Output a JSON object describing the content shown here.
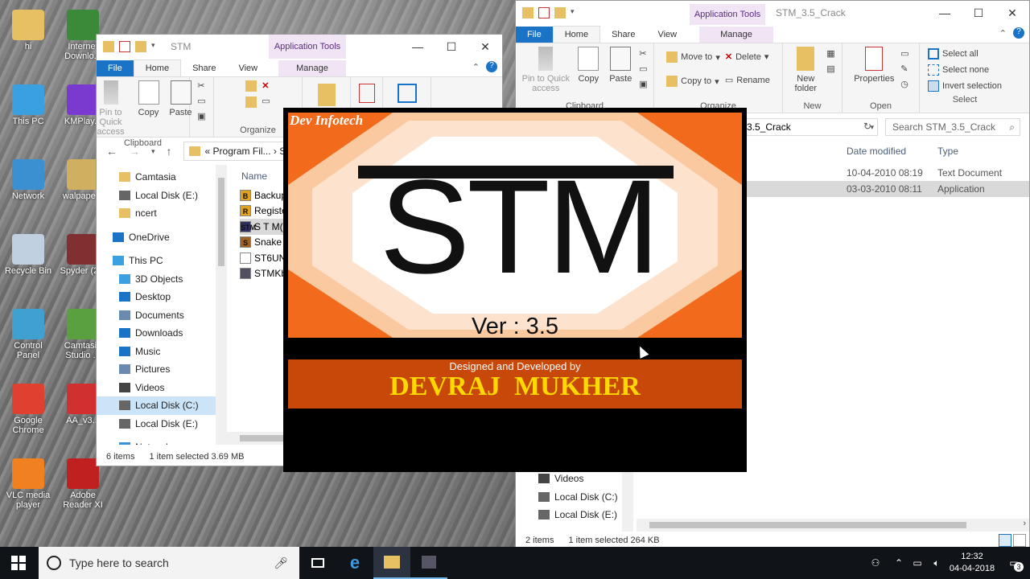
{
  "desktop": {
    "icons": [
      {
        "label": "hi",
        "color": "#e8c064"
      },
      {
        "label": "Internet Downlo...",
        "color": "#3a8a3a"
      },
      {
        "label": "This PC",
        "color": "#3aa0e0"
      },
      {
        "label": "KMPlay...",
        "color": "#7a3ad0"
      },
      {
        "label": "Network",
        "color": "#3a90d0"
      },
      {
        "label": "walpape...",
        "color": "#d0b060"
      },
      {
        "label": "Recycle Bin",
        "color": "#c0d0e0"
      },
      {
        "label": "Spyder (2...",
        "color": "#803030"
      },
      {
        "label": "Control Panel",
        "color": "#40a0d0"
      },
      {
        "label": "Camtasia Studio ...",
        "color": "#5aa040"
      },
      {
        "label": "Google Chrome",
        "color": "#e04030"
      },
      {
        "label": "AA_v3...",
        "color": "#d03030"
      },
      {
        "label": "VLC media player",
        "color": "#f08020"
      },
      {
        "label": "Adobe Reader XI",
        "color": "#c02020"
      }
    ]
  },
  "explorer_left": {
    "title": "STM",
    "app_tools": "Application Tools",
    "tabs": {
      "file": "File",
      "home": "Home",
      "share": "Share",
      "view": "View",
      "manage": "Manage"
    },
    "ribbon": {
      "pin": "Pin to Quick access",
      "copy": "Copy",
      "paste": "Paste",
      "clipboard": "Clipboard",
      "organize": "Organize"
    },
    "address": "« Program Fil... › ST",
    "nav": [
      {
        "label": "Camtasia",
        "color": "#e8c064"
      },
      {
        "label": "Local Disk (E:)",
        "color": "#666"
      },
      {
        "label": "ncert",
        "color": "#e8c064"
      },
      {
        "label": "OneDrive",
        "color": "#1a73c6"
      },
      {
        "label": "This PC",
        "color": "#3aa0e0"
      },
      {
        "label": "3D Objects",
        "color": "#3aa0e0"
      },
      {
        "label": "Desktop",
        "color": "#1a73c6"
      },
      {
        "label": "Documents",
        "color": "#6a8ab0"
      },
      {
        "label": "Downloads",
        "color": "#1a73c6"
      },
      {
        "label": "Music",
        "color": "#1a73c6"
      },
      {
        "label": "Pictures",
        "color": "#6a8ab0"
      },
      {
        "label": "Videos",
        "color": "#444"
      },
      {
        "label": "Local Disk (C:)",
        "color": "#666"
      },
      {
        "label": "Local Disk (E:)",
        "color": "#666"
      },
      {
        "label": "Network",
        "color": "#3a90d0"
      }
    ],
    "col_name": "Name",
    "files": [
      {
        "name": "Backup",
        "icon": "B",
        "color": "#e0a020"
      },
      {
        "name": "Register",
        "icon": "R",
        "color": "#e0a020"
      },
      {
        "name": "S T M(C)",
        "icon": "STM",
        "color": "#303060"
      },
      {
        "name": "Snake",
        "icon": "S",
        "color": "#a06020"
      },
      {
        "name": "ST6UNST",
        "icon": "",
        "color": "#fff"
      },
      {
        "name": "STMKbDr",
        "icon": "",
        "color": "#505060"
      }
    ],
    "status": {
      "items": "6 items",
      "selected": "1 item selected  3.69 MB"
    }
  },
  "explorer_right": {
    "title": "STM_3.5_Crack",
    "app_tools": "Application Tools",
    "tabs": {
      "file": "File",
      "home": "Home",
      "share": "Share",
      "view": "View",
      "manage": "Manage"
    },
    "ribbon": {
      "pin": "Pin to Quick access",
      "copy": "Copy",
      "paste": "Paste",
      "move_to": "Move to",
      "copy_to": "Copy to",
      "delete": "Delete",
      "rename": "Rename",
      "new_folder": "New folder",
      "properties": "Properties",
      "select_all": "Select all",
      "select_none": "Select none",
      "invert": "Invert selection",
      "g_clipboard": "Clipboard",
      "g_organize": "Organize",
      "g_new": "New",
      "g_open": "Open",
      "g_select": "Select"
    },
    "address": "3.5_Crack",
    "search_placeholder": "Search STM_3.5_Crack",
    "cols": {
      "date": "Date modified",
      "type": "Type"
    },
    "rows": [
      {
        "date": "10-04-2010 08:19",
        "type": "Text Document"
      },
      {
        "date": "03-03-2010 08:11",
        "type": "Application"
      }
    ],
    "nav": [
      {
        "label": "Videos",
        "color": "#444"
      },
      {
        "label": "Local Disk (C:)",
        "color": "#666"
      },
      {
        "label": "Local Disk (E:)",
        "color": "#666"
      }
    ],
    "status": {
      "items": "2 items",
      "selected": "1 item selected  264 KB"
    }
  },
  "splash": {
    "company": "Dev Infotech",
    "logo": "STM",
    "version": "Ver : 3.5",
    "designed": "Designed and Developed by",
    "author": "DEVRAJ  MUKHER"
  },
  "taskbar": {
    "search_placeholder": "Type here to search",
    "time": "12:32",
    "date": "04-04-2018",
    "notifications": "3"
  }
}
